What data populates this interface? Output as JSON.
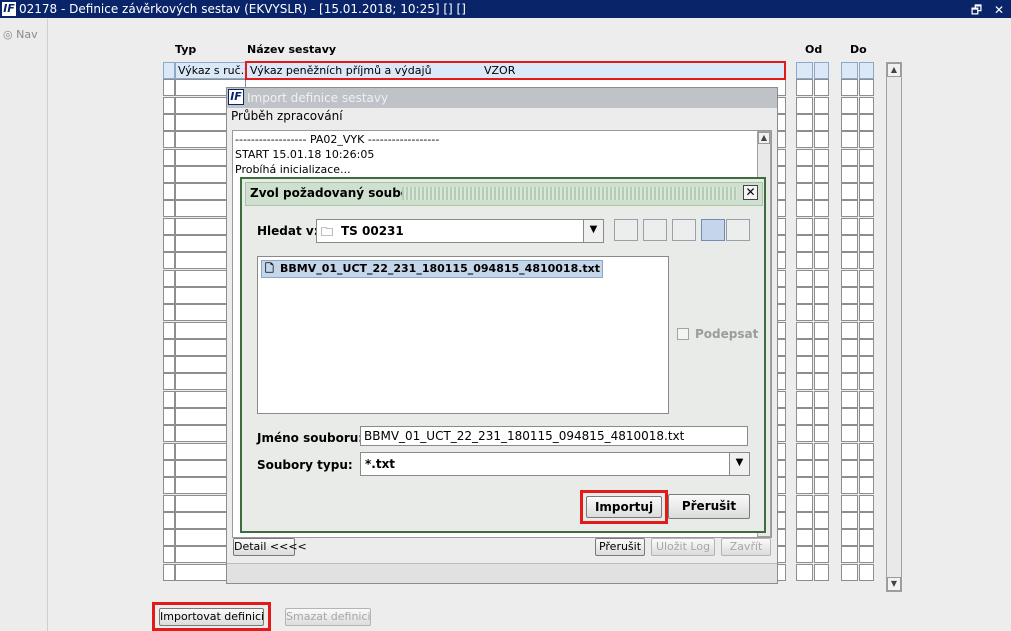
{
  "window": {
    "title": "02178 - Definice závěrkových sestav (EKVYSLR) - [15.01.2018; 10:25] [] []",
    "logo": "IF",
    "controls": "🗗 ✕"
  },
  "nav": {
    "label": "Nav"
  },
  "table": {
    "headers": {
      "typ": "Typ",
      "nazev": "Název sestavy",
      "od": "Od",
      "do": "Do"
    },
    "first_row": {
      "typ": "Výkaz s ruč.v",
      "nazev": "Výkaz peněžních příjmů a výdajů",
      "code": "VZOR"
    }
  },
  "import_dialog": {
    "title": "Import definice sestavy",
    "progress_label": "Průběh zpracování",
    "log_lines": [
      "------------------ PA02_VYK ------------------",
      "START 15.01.18 10:26:05",
      "Probíhá inicializace..."
    ],
    "detail_button": "Detail <<<<",
    "cancel_button": "Přerušit",
    "save_log_button": "Uložit Log",
    "close_button": "Zavřít"
  },
  "file_chooser": {
    "title": "Zvol požadovaný soubor...",
    "look_in_label": "Hledat v:",
    "look_in_value": "TS 00231",
    "files": [
      "BBMV_01_UCT_22_231_180115_094815_4810018.txt"
    ],
    "sign_label": "Podepsat",
    "filename_label": "Jméno souboru:",
    "filename_value": "BBMV_01_UCT_22_231_180115_094815_4810018.txt",
    "filetype_label": "Soubory typu:",
    "filetype_value": "*.txt",
    "import_button": "Importuj",
    "cancel_button": "Přerušit",
    "icons": [
      "up-folder-icon",
      "home-icon",
      "new-folder-icon",
      "list-view-icon",
      "details-view-icon"
    ]
  },
  "bottom": {
    "import_button": "Importovat definici",
    "delete_button": "Smazat definici"
  },
  "colors": {
    "titlebar": "#0a246a",
    "highlight": "#e21a1a",
    "chooser_border": "#3d6c3d"
  }
}
